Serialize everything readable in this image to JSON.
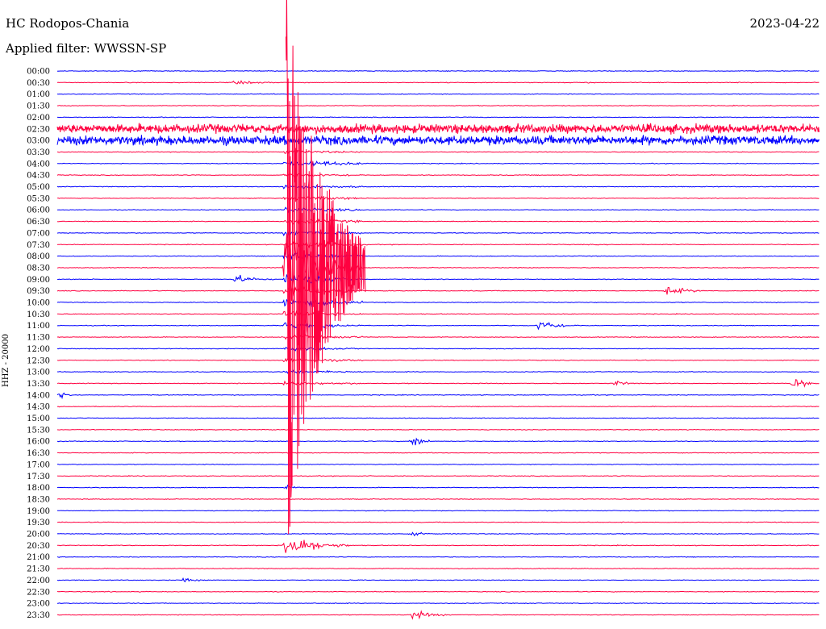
{
  "header": {
    "station": "HC Rodopos-Chania",
    "date": "2023-04-22",
    "filter": "Applied filter: WWSSN-SP"
  },
  "chart_data": {
    "type": "line",
    "title": "HC Rodopos-Chania",
    "ylabel": "HHZ - 20000",
    "xlabel": "",
    "trace_colors": [
      "#0000ff",
      "#ff0040"
    ],
    "rows": [
      "00:00",
      "00:30",
      "01:00",
      "01:30",
      "02:00",
      "02:30",
      "03:00",
      "03:30",
      "04:00",
      "04:30",
      "05:00",
      "05:30",
      "06:00",
      "06:30",
      "07:00",
      "07:30",
      "08:00",
      "08:30",
      "09:00",
      "09:30",
      "10:00",
      "10:30",
      "11:00",
      "11:30",
      "12:00",
      "12:30",
      "13:00",
      "13:30",
      "14:00",
      "14:30",
      "15:00",
      "15:30",
      "16:00",
      "16:30",
      "17:00",
      "17:30",
      "18:00",
      "18:30",
      "19:00",
      "19:30",
      "20:00",
      "20:30",
      "21:00",
      "21:30",
      "22:00",
      "22:30",
      "23:00",
      "23:30"
    ],
    "events": [
      {
        "row": 1,
        "minute": 7,
        "amp": 3,
        "dur": 2
      },
      {
        "row": 1,
        "minute": 21,
        "amp": 2,
        "dur": 1
      },
      {
        "row": 8,
        "minute": 10,
        "amp": 4,
        "dur": 3
      },
      {
        "row": 17,
        "minute": 9,
        "amp": 120,
        "dur": 3
      },
      {
        "row": 18,
        "minute": 7,
        "amp": 10,
        "dur": 1.5
      },
      {
        "row": 19,
        "minute": 24,
        "amp": 12,
        "dur": 1.5
      },
      {
        "row": 20,
        "minute": 10,
        "amp": 8,
        "dur": 1
      },
      {
        "row": 22,
        "minute": 19,
        "amp": 14,
        "dur": 1.5
      },
      {
        "row": 27,
        "minute": 22,
        "amp": 6,
        "dur": 1
      },
      {
        "row": 27,
        "minute": 29,
        "amp": 14,
        "dur": 1
      },
      {
        "row": 28,
        "minute": 0,
        "amp": 8,
        "dur": 1
      },
      {
        "row": 32,
        "minute": 14,
        "amp": 16,
        "dur": 0.8
      },
      {
        "row": 36,
        "minute": 9,
        "amp": 6,
        "dur": 0.8
      },
      {
        "row": 40,
        "minute": 14,
        "amp": 4,
        "dur": 1
      },
      {
        "row": 41,
        "minute": 9,
        "amp": 30,
        "dur": 2.5
      },
      {
        "row": 44,
        "minute": 5,
        "amp": 4,
        "dur": 1
      },
      {
        "row": 47,
        "minute": 14,
        "amp": 10,
        "dur": 1.5
      }
    ],
    "noisy_rows": [
      5,
      6
    ],
    "x_minutes": [
      0,
      30
    ],
    "grid": false,
    "legend": "none"
  }
}
